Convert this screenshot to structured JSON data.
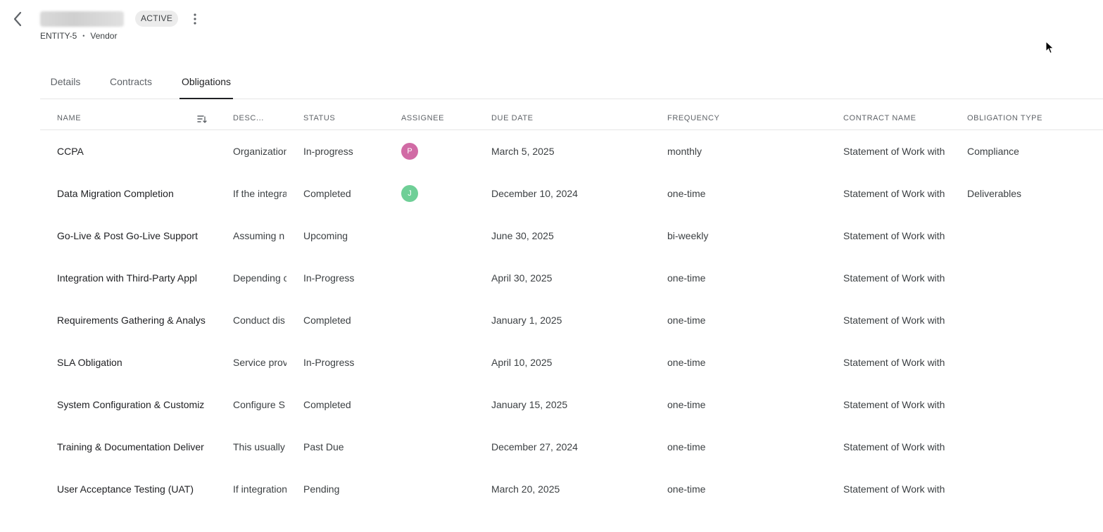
{
  "header": {
    "status_badge": "ACTIVE",
    "entity_id": "ENTITY-5",
    "separator": "•",
    "entity_type": "Vendor"
  },
  "tabs": [
    {
      "label": "Details",
      "active": false
    },
    {
      "label": "Contracts",
      "active": false
    },
    {
      "label": "Obligations",
      "active": true
    }
  ],
  "table": {
    "columns": [
      "NAME",
      "DESC...",
      "STATUS",
      "ASSIGNEE",
      "DUE DATE",
      "FREQUENCY",
      "CONTRACT NAME",
      "OBLIGATION TYPE"
    ],
    "rows": [
      {
        "name": "CCPA",
        "description": "Organization",
        "status": "In-progress",
        "assignee": "P",
        "assignee_color": "#d16ba5",
        "due_date": "March 5, 2025",
        "frequency": "monthly",
        "contract": "Statement of Work with",
        "type": "Compliance"
      },
      {
        "name": "Data Migration Completion",
        "description": "If the integra",
        "status": "Completed",
        "assignee": "J",
        "assignee_color": "#6fcf97",
        "due_date": "December 10, 2024",
        "frequency": "one-time",
        "contract": "Statement of Work with",
        "type": "Deliverables"
      },
      {
        "name": "Go-Live & Post Go-Live Support",
        "description": "Assuming n",
        "status": "Upcoming",
        "assignee": "",
        "assignee_color": "",
        "due_date": "June 30, 2025",
        "frequency": "bi-weekly",
        "contract": "Statement of Work with",
        "type": ""
      },
      {
        "name": "Integration with Third-Party Appl",
        "description": "Depending c",
        "status": "In-Progress",
        "assignee": "",
        "assignee_color": "",
        "due_date": "April 30, 2025",
        "frequency": "one-time",
        "contract": "Statement of Work with",
        "type": ""
      },
      {
        "name": "Requirements Gathering & Analys",
        "description": "Conduct dis",
        "status": "Completed",
        "assignee": "",
        "assignee_color": "",
        "due_date": "January 1, 2025",
        "frequency": "one-time",
        "contract": "Statement of Work with",
        "type": ""
      },
      {
        "name": "SLA Obligation",
        "description": "Service prov",
        "status": "In-Progress",
        "assignee": "",
        "assignee_color": "",
        "due_date": "April 10, 2025",
        "frequency": "one-time",
        "contract": "Statement of Work with",
        "type": ""
      },
      {
        "name": "System Configuration & Customiz",
        "description": "Configure S",
        "status": "Completed",
        "assignee": "",
        "assignee_color": "",
        "due_date": "January 15, 2025",
        "frequency": "one-time",
        "contract": "Statement of Work with",
        "type": ""
      },
      {
        "name": "Training & Documentation Deliver",
        "description": "This usually",
        "status": "Past Due",
        "assignee": "",
        "assignee_color": "",
        "due_date": "December 27, 2024",
        "frequency": "one-time",
        "contract": "Statement of Work with",
        "type": ""
      },
      {
        "name": "User Acceptance Testing (UAT)",
        "description": "If integration",
        "status": "Pending",
        "assignee": "",
        "assignee_color": "",
        "due_date": "March 20, 2025",
        "frequency": "one-time",
        "contract": "Statement of Work with",
        "type": ""
      }
    ]
  },
  "icons": {
    "back": "chevron-left-icon",
    "menu": "more-vertical-icon",
    "sort": "sort-icon"
  }
}
